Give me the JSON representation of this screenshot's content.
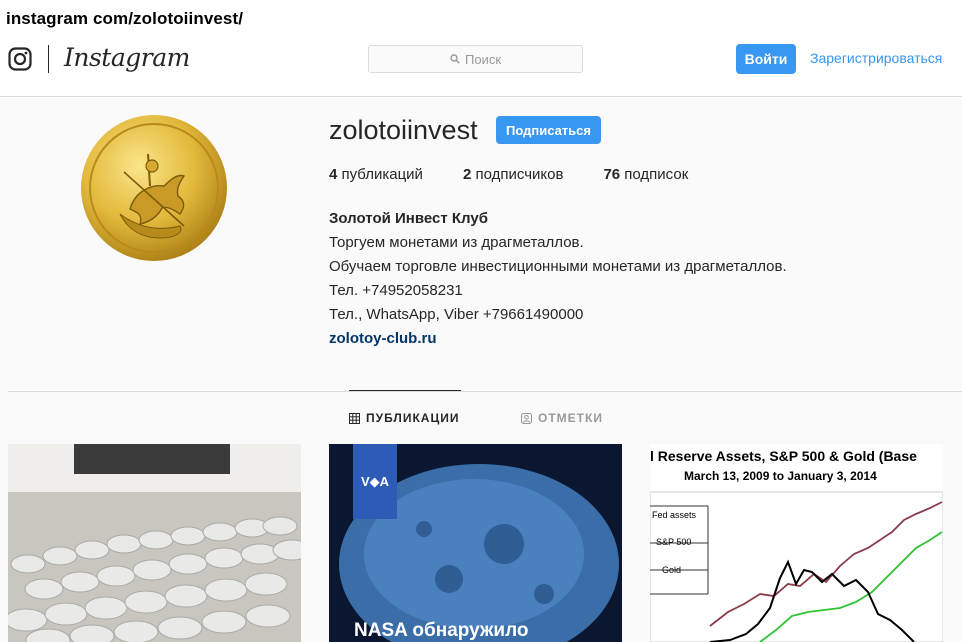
{
  "url": "instagram com/zolotoiinvest/",
  "nav": {
    "brand": "Instagram",
    "search_placeholder": "Поиск",
    "login_label": "Войти",
    "register_label": "Зарегистрироваться"
  },
  "profile": {
    "username": "zolotoiinvest",
    "follow_label": "Подписаться",
    "stats": {
      "posts_count": "4",
      "posts_label": "публикаций",
      "followers_count": "2",
      "followers_label": "подписчиков",
      "following_count": "76",
      "following_label": "подписок"
    },
    "bio": {
      "name": "Золотой Инвест Клуб",
      "lines": [
        "Торгуем монетами из драгметаллов.",
        "Обучаем торговле инвестиционными монетами из драгметаллов.",
        "Тел. +74952058231",
        "Тел., WhatsApp, Viber +79661490000"
      ],
      "website": "zolotoy-club.ru"
    }
  },
  "tabs": {
    "posts": "ПУБЛИКАЦИИ",
    "tagged": "ОТМЕТКИ"
  },
  "posts": {
    "post2_badge": "V◆A",
    "post2_caption": "NASA обнаружило",
    "post3_title": "l Reserve Assets, S&P 500 & Gold (Base",
    "post3_subtitle": "March 13, 2009 to January 3, 2014",
    "post3_legend": [
      "Fed assets",
      "S&P 500",
      "Gold"
    ]
  },
  "colors": {
    "accent": "#3897f0",
    "link": "#003569",
    "border": "#dbdbdb",
    "background": "#fafafa"
  }
}
